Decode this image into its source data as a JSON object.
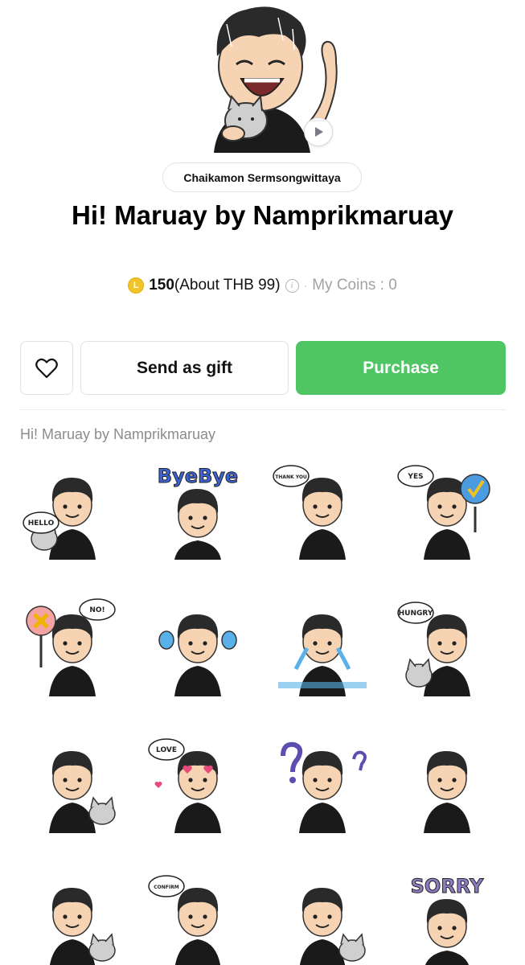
{
  "product": {
    "author": "Chaikamon Sermsongwittaya",
    "title": "Hi! Maruay by Namprikmaruay",
    "coin_symbol": "L",
    "price": "150",
    "price_about": "(About THB 99)",
    "info_symbol": "i",
    "separator": "·",
    "my_coins": "My Coins : 0"
  },
  "actions": {
    "gift_label": "Send as gift",
    "purchase_label": "Purchase"
  },
  "section": {
    "label": "Hi! Maruay by Namprikmaruay"
  },
  "colors": {
    "purchase_green": "#4fc564",
    "coin_gold": "#f2c42a",
    "muted_text": "#8c8c8c",
    "skin": "#f6d3b3",
    "hair": "#2a2a2a",
    "shirt": "#1a1a1a"
  },
  "stickers": [
    {
      "name": "sticker-hello",
      "caption": "HELLO",
      "accent": "#f0b400",
      "extra": "cat-left"
    },
    {
      "name": "sticker-byebye",
      "caption": "ByeBye",
      "accent": "#3a63d6",
      "extra": "banner"
    },
    {
      "name": "sticker-thank-you",
      "caption": "THANK YOU",
      "accent": "#222222",
      "extra": "bubble"
    },
    {
      "name": "sticker-yes",
      "caption": "YES",
      "accent": "#4a9be0",
      "extra": "check-sign"
    },
    {
      "name": "sticker-no",
      "caption": "NO!",
      "accent": "#e94b3c",
      "extra": "x-sign"
    },
    {
      "name": "sticker-maracas",
      "caption": "",
      "accent": "#5ab0e8",
      "extra": "maracas"
    },
    {
      "name": "sticker-crying",
      "caption": "",
      "accent": "#5ab0e8",
      "extra": "tears"
    },
    {
      "name": "sticker-hungry",
      "caption": "HUNGRY",
      "accent": "#e67e22",
      "extra": "cat-left"
    },
    {
      "name": "sticker-angry",
      "caption": "",
      "accent": "#d9a400",
      "extra": "cat-right"
    },
    {
      "name": "sticker-love",
      "caption": "LOVE",
      "accent": "#e84a7a",
      "extra": "hearts"
    },
    {
      "name": "sticker-confused",
      "caption": "",
      "accent": "#5a4fb0",
      "extra": "question"
    },
    {
      "name": "sticker-flex",
      "caption": "",
      "accent": "#222222",
      "extra": "none"
    },
    {
      "name": "sticker-sleepy",
      "caption": "",
      "accent": "#999999",
      "extra": "cat-right"
    },
    {
      "name": "sticker-confirm",
      "caption": "CONFIRM",
      "accent": "#222222",
      "extra": "bubble"
    },
    {
      "name": "sticker-cool",
      "caption": "",
      "accent": "#222222",
      "extra": "cat-right"
    },
    {
      "name": "sticker-sorry",
      "caption": "SORRY",
      "accent": "#8e7cc3",
      "extra": "banner"
    }
  ]
}
